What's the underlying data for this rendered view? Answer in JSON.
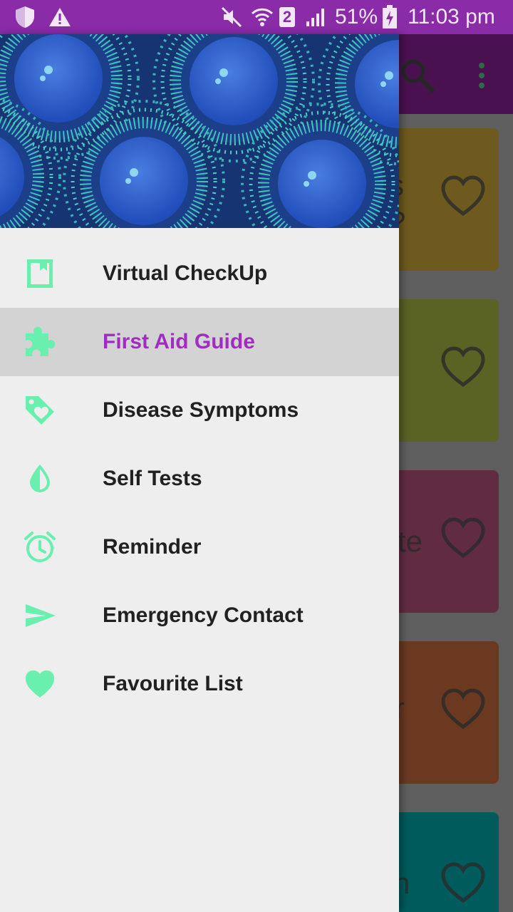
{
  "status_bar": {
    "battery": "51%",
    "time": "11:03 pm",
    "sim": "2",
    "icons": [
      "shield-icon",
      "warning-icon",
      "mute-icon",
      "wifi-icon",
      "sim-icon",
      "signal-icon",
      "battery-icon"
    ]
  },
  "app_bar": {
    "icons": [
      "search-icon",
      "overflow-menu-icon"
    ]
  },
  "cards": [
    {
      "peek": "s\n?",
      "color": "#6e5a1e"
    },
    {
      "peek": "",
      "color": "#5a6224"
    },
    {
      "peek": "te",
      "color": "#612c41"
    },
    {
      "peek": "r",
      "color": "#6b3920"
    },
    {
      "peek": "n",
      "color": "#005b5c"
    }
  ],
  "drawer": {
    "accent": "#69f0ae",
    "selected_color": "#a02dc0",
    "items": [
      {
        "label": "Virtual CheckUp",
        "icon": "bookmark-icon",
        "selected": false
      },
      {
        "label": "First Aid Guide",
        "icon": "puzzle-icon",
        "selected": true
      },
      {
        "label": "Disease Symptoms",
        "icon": "tag-heart-icon",
        "selected": false
      },
      {
        "label": "Self Tests",
        "icon": "contrast-drop-icon",
        "selected": false
      },
      {
        "label": "Reminder",
        "icon": "alarm-icon",
        "selected": false
      },
      {
        "label": "Emergency Contact",
        "icon": "send-icon",
        "selected": false
      },
      {
        "label": "Favourite List",
        "icon": "heart-icon",
        "selected": false
      }
    ]
  }
}
